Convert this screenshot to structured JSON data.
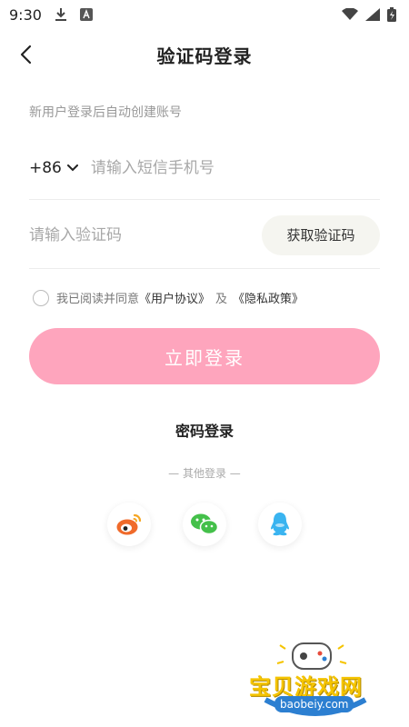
{
  "status_bar": {
    "time": "9:30",
    "icons": [
      "download-icon",
      "app-a-icon",
      "wifi-icon",
      "signal-icon",
      "battery-icon"
    ]
  },
  "header": {
    "title": "验证码登录",
    "back_icon": "chevron-left-icon"
  },
  "hint": "新用户登录后自动创建账号",
  "phone": {
    "country_code": "+86",
    "placeholder": "请输入短信手机号",
    "value": ""
  },
  "code": {
    "placeholder": "请输入验证码",
    "value": "",
    "get_code_label": "获取验证码"
  },
  "agreement": {
    "prefix": "我已阅读并同意",
    "user_agreement": "《用户协议》",
    "and": "及",
    "privacy_policy": "《隐私政策》",
    "checked": false
  },
  "login_button": "立即登录",
  "password_login": "密码登录",
  "other_login": "— 其他登录 —",
  "social": [
    {
      "name": "weibo",
      "icon": "weibo-icon"
    },
    {
      "name": "wechat",
      "icon": "wechat-icon"
    },
    {
      "name": "qq",
      "icon": "qq-icon"
    }
  ],
  "colors": {
    "login_button": "#fea5bd",
    "weibo": "#f06a2a",
    "wechat": "#44c04a",
    "qq": "#3ab4f0"
  },
  "watermark": {
    "cn": "宝贝游戏网",
    "en": "baobeiy.com"
  }
}
